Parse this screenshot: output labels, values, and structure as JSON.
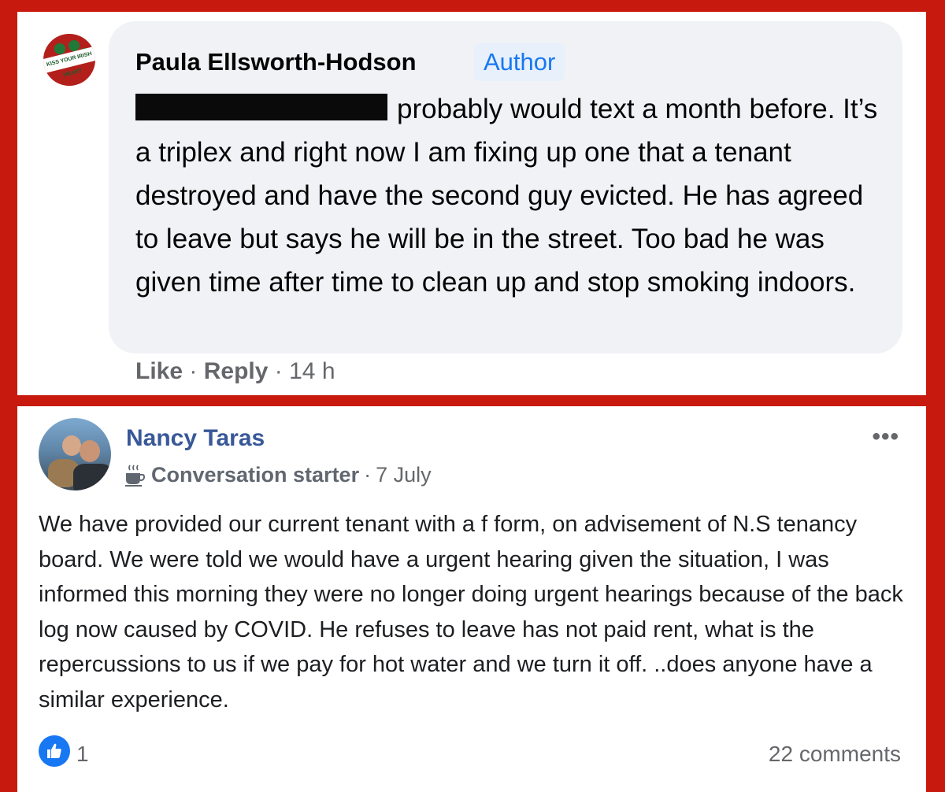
{
  "comment": {
    "author": "Paula Ellsworth-Hodson",
    "badge": "Author",
    "text": "probably would text a month before. It’s a triplex and right now I am fixing up one that a tenant destroyed and have the second guy evicted. He has agreed to leave but says he will be in the street. Too bad he was given time after time to clean up and stop smoking indoors.",
    "like_label": "Like",
    "separator": "·",
    "reply_label": "Reply",
    "time": "14 h",
    "avatar_text": "KISS YOUR IRISH HEART"
  },
  "post": {
    "author": "Nancy Taras",
    "badge_icon": "coffee-cup-icon",
    "badge_label": "Conversation starter",
    "separator": "·",
    "date": "7 July",
    "more": "•••",
    "text": "We have provided our current tenant with a f form, on advisement of N.S tenancy board. We were told we would have a urgent hearing given the situation, I was informed this morning they were no longer doing urgent hearings because of the back log now caused by COVID. He refuses to leave has not paid rent, what is the repercussions to us if we pay for hot water and we turn it off. ..does anyone have a similar experience.",
    "reaction_icon": "thumbs-up-icon",
    "reaction_count": "1",
    "comments": "22 comments"
  },
  "colors": {
    "frame": "#c8190f",
    "bubble": "#f0f2f5",
    "link_blue": "#385898",
    "fb_blue": "#1877f2",
    "muted": "#65676b"
  }
}
